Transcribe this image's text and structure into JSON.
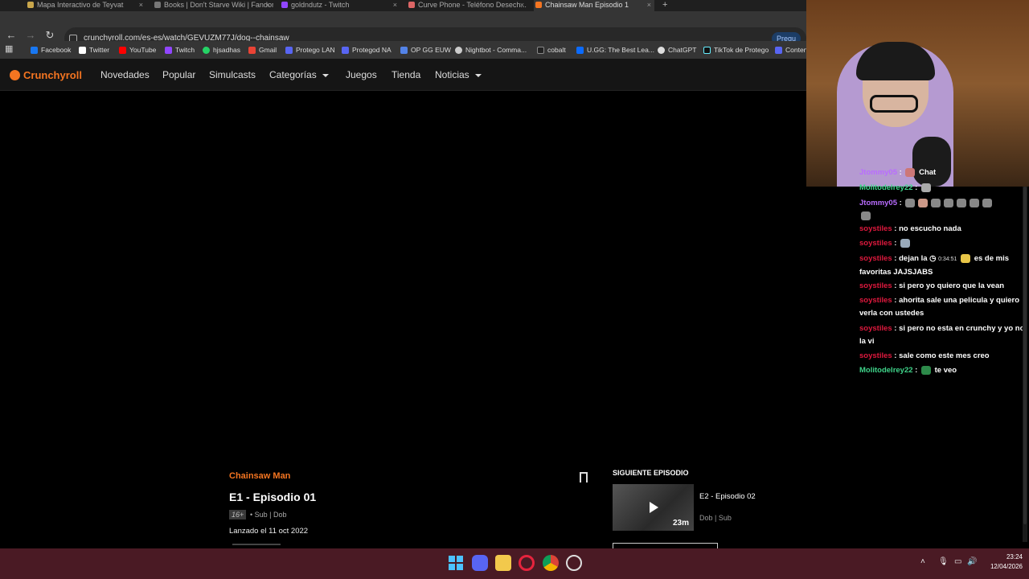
{
  "browser": {
    "tabs": [
      {
        "label": "Mapa Interactivo de Teyvat",
        "color": "#c9a64b"
      },
      {
        "label": "Books | Don't Starve Wiki | Fandom",
        "color": "#777"
      },
      {
        "label": "goldndutz - Twitch",
        "color": "#9146ff"
      },
      {
        "label": "Curve Phone - Teléfono Desech...",
        "color": "#d66"
      },
      {
        "label": "Chainsaw Man Episodio 1",
        "color": "#f47521"
      }
    ],
    "new_tab": "+",
    "url": "crunchyroll.com/es-es/watch/GEVUZM77J/dog--chainsaw",
    "ask_label": "Pregu",
    "bookmarks": [
      {
        "label": "Facebook",
        "color": "#1877f2"
      },
      {
        "label": "Twitter",
        "color": "#ffffff"
      },
      {
        "label": "YouTube",
        "color": "#ff0000"
      },
      {
        "label": "Twitch",
        "color": "#9146ff"
      },
      {
        "label": "hjsadhas",
        "color": "#25d366"
      },
      {
        "label": "Gmail",
        "color": "#ea4335"
      },
      {
        "label": "Protego LAN",
        "color": "#5865f2"
      },
      {
        "label": "Protegod NA",
        "color": "#5865f2"
      },
      {
        "label": "OP GG EUW",
        "color": "#5383e8"
      },
      {
        "label": "Nightbot - Comma...",
        "color": "#cccccc"
      },
      {
        "label": "cobalt",
        "color": "#222222"
      },
      {
        "label": "U.GG: The Best Lea...",
        "color": "#0b6bff"
      },
      {
        "label": "ChatGPT",
        "color": "#dddddd"
      },
      {
        "label": "TikTok de Protego",
        "color": "#111111"
      },
      {
        "label": "Conten",
        "color": "#5865f2"
      }
    ]
  },
  "crunchyroll": {
    "logo": "Crunchyroll",
    "nav": [
      "Novedades",
      "Popular",
      "Simulcasts",
      "Categorías",
      "Juegos",
      "Tienda",
      "Noticias"
    ],
    "series": "Chainsaw Man",
    "episode_title": "E1 - Episodio 01",
    "rating": "16+",
    "audio": "• Sub | Dob",
    "released": "Lanzado el 11 oct 2022",
    "next_heading": "SIGUIENTE EPISODIO",
    "next_title": "E2 - Episodio 02",
    "next_audio": "Dob | Sub",
    "next_duration": "23m"
  },
  "chat": [
    {
      "user": "Jtommy05",
      "color": "#b96cff",
      "text": "Chat"
    },
    {
      "user": "Molitodelrey22",
      "color": "#3fd48a",
      "text": ""
    },
    {
      "user": "Jtommy05",
      "color": "#b96cff",
      "text": ""
    },
    {
      "user": "soystiles",
      "color": "#e0193e",
      "text": "no escucho nada"
    },
    {
      "user": "soystiles",
      "color": "#e0193e",
      "text": ""
    },
    {
      "user": "soystiles",
      "color": "#e0193e",
      "text": "dejan la",
      "ts": "0:34:51",
      "text2": "es de mis favoritas JAJSJABS"
    },
    {
      "user": "soystiles",
      "color": "#e0193e",
      "text": "si pero yo quiero que la vean"
    },
    {
      "user": "soystiles",
      "color": "#e0193e",
      "text": "ahorita sale una pelicula y quiero verla con ustedes"
    },
    {
      "user": "soystiles",
      "color": "#e0193e",
      "text": "si pero no esta en crunchy y yo no la vi"
    },
    {
      "user": "soystiles",
      "color": "#e0193e",
      "text": "sale como este mes creo"
    },
    {
      "user": "Molitodelrey22",
      "color": "#3fd48a",
      "text": "te veo"
    }
  ],
  "taskbar": {
    "time": "23:24",
    "date": "12/04/2026",
    "apps": [
      "windows-start",
      "discord",
      "file-explorer",
      "opera",
      "chrome",
      "steam"
    ]
  }
}
